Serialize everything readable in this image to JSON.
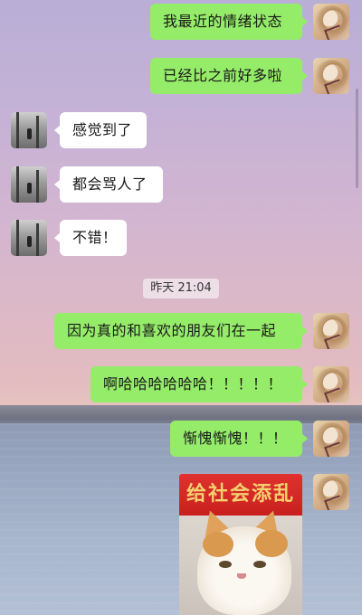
{
  "chat": {
    "messages": [
      {
        "side": "self",
        "text": "我最近的情绪状态"
      },
      {
        "side": "self",
        "text": "已经比之前好多啦"
      },
      {
        "side": "other",
        "text": "感觉到了"
      },
      {
        "side": "other",
        "text": "都会骂人了"
      },
      {
        "side": "other",
        "text": "不错！"
      },
      {
        "side": "self",
        "text": "因为真的和喜欢的朋友们在一起"
      },
      {
        "side": "self",
        "text": "啊哈哈哈哈哈哈！！！！！"
      },
      {
        "side": "self",
        "text": "惭愧惭愧！！！"
      }
    ],
    "timestamp": "昨天 21:04",
    "sticker": {
      "banner_text": "给社会添乱",
      "icon": "cat-meme-sticker"
    }
  },
  "colors": {
    "self_bubble": "#95ec69",
    "other_bubble": "#ffffff"
  }
}
